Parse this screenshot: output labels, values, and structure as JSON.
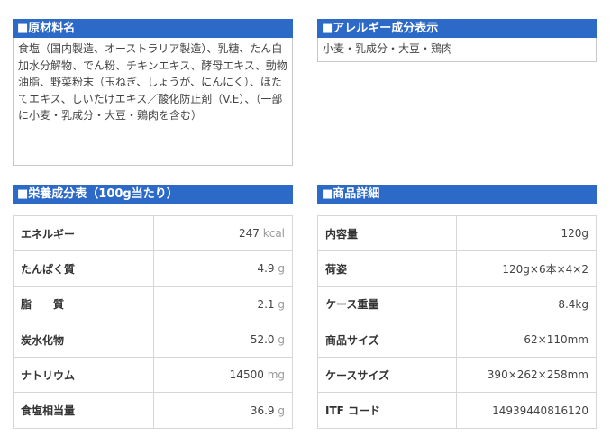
{
  "ingredients": {
    "title": "■原材料名",
    "text": "食塩（国内製造、オーストラリア製造）、乳糖、たん白加水分解物、でん粉、チキンエキス、酵母エキス、動物油脂、野菜粉末（玉ねぎ、しょうが、にんにく）、ほたてエキス、しいたけエキス／酸化防止剤（V.E）、（一部に小麦・乳成分・大豆・鶏肉を含む）"
  },
  "allergy": {
    "title": "■アレルギー成分表示",
    "text": "小麦・乳成分・大豆・鶏肉"
  },
  "nutrition": {
    "title": "■栄養成分表（100g当たり）",
    "rows": [
      {
        "label": "エネルギー",
        "value": "247",
        "unit": "kcal"
      },
      {
        "label": "たんぱく質",
        "value": "4.9",
        "unit": "g"
      },
      {
        "label": "脂　　質",
        "value": "2.1",
        "unit": "g"
      },
      {
        "label": "炭水化物",
        "value": "52.0",
        "unit": "g"
      },
      {
        "label": "ナトリウム",
        "value": "14500",
        "unit": "mg"
      },
      {
        "label": "食塩相当量",
        "value": "36.9",
        "unit": "g"
      }
    ]
  },
  "details": {
    "title": "■商品詳細",
    "rows": [
      {
        "label": "内容量",
        "value": "120g"
      },
      {
        "label": "荷姿",
        "value": "120g×6本×4×2"
      },
      {
        "label": "ケース重量",
        "value": "8.4kg"
      },
      {
        "label": "商品サイズ",
        "value": "62×110mm"
      },
      {
        "label": "ケースサイズ",
        "value": "390×262×258mm"
      },
      {
        "label": "ITF コード",
        "value": "14939440816120"
      }
    ]
  }
}
